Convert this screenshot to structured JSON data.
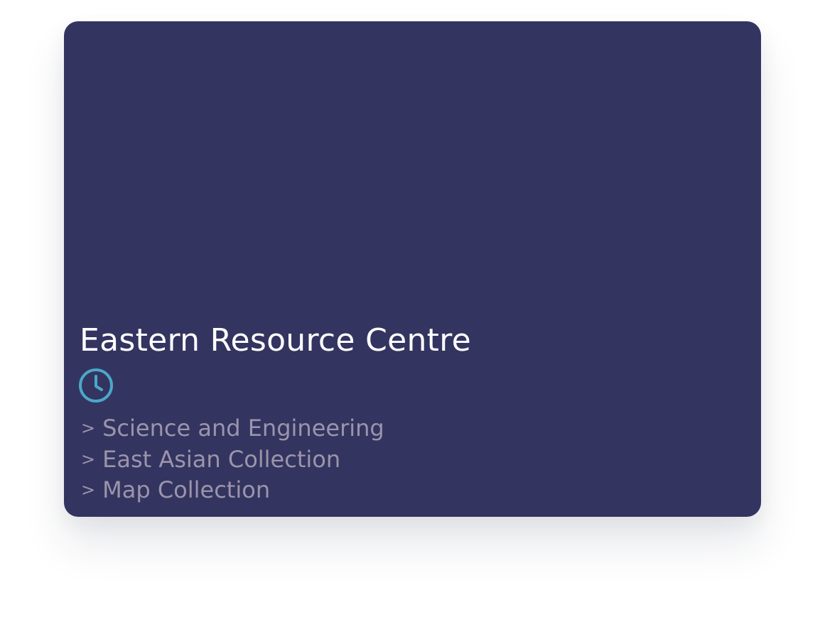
{
  "card": {
    "title": "Eastern Resource Centre",
    "hours_icon": "clock-icon",
    "links": [
      {
        "prefix": ">",
        "label": "Science and Engineering"
      },
      {
        "prefix": ">",
        "label": "East Asian Collection"
      },
      {
        "prefix": ">",
        "label": "Map Collection"
      }
    ]
  },
  "colors": {
    "card_background": "#343461",
    "accent": "#4aa8c8",
    "link_text": "#9b95aa",
    "title_text": "#ffffff"
  }
}
